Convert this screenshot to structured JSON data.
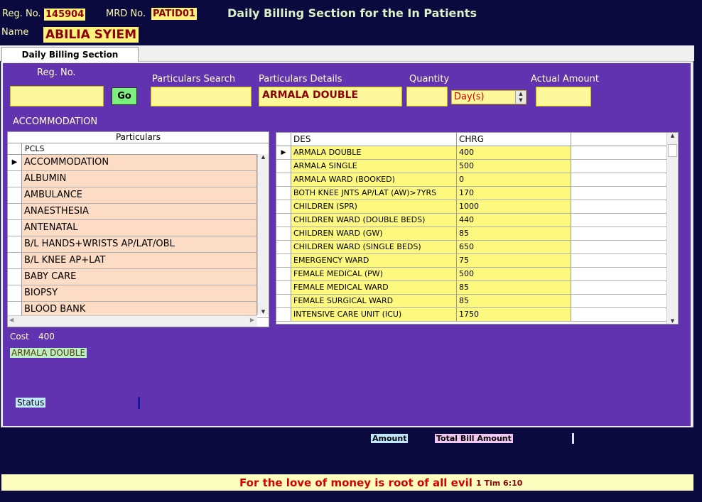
{
  "header": {
    "reg_label": "Reg. No.",
    "reg_value": "145904",
    "mrd_label": "MRD No.",
    "mrd_value": "PATID01",
    "title": "Daily Billing Section for the In Patients",
    "name_label": "Name",
    "name_value": "ABILIA SYIEM"
  },
  "tab": {
    "label": "Daily Billing Section"
  },
  "form": {
    "reg_label": "Reg. No.",
    "go_label": "Go",
    "search_label": "Particulars Search",
    "details_label": "Particulars Details",
    "details_value": "ARMALA DOUBLE",
    "quantity_label": "Quantity",
    "unit_value": "Day(s)",
    "actual_label": "Actual Amount",
    "category": "ACCOMMODATION"
  },
  "particulars_grid": {
    "caption": "Particulars",
    "column": "PCLS",
    "rows": [
      "ACCOMMODATION",
      "ALBUMIN",
      "AMBULANCE",
      "ANAESTHESIA",
      "ANTENATAL",
      "B/L HANDS+WRISTS AP/LAT/OBL",
      "B/L KNEE AP+LAT",
      "BABY CARE",
      "BIOPSY",
      "BLOOD BANK"
    ]
  },
  "charges_grid": {
    "col_des": "DES",
    "col_chrg": "CHRG",
    "rows": [
      {
        "des": "ARMALA DOUBLE",
        "chrg": "400"
      },
      {
        "des": "ARMALA SINGLE",
        "chrg": "500"
      },
      {
        "des": "ARMALA WARD (BOOKED)",
        "chrg": "0"
      },
      {
        "des": "BOTH KNEE JNTS AP/LAT (AW)>7YRS",
        "chrg": "170"
      },
      {
        "des": "CHILDREN (SPR)",
        "chrg": "1000"
      },
      {
        "des": "CHILDREN WARD (DOUBLE BEDS)",
        "chrg": "440"
      },
      {
        "des": "CHILDREN WARD (GW)",
        "chrg": "85"
      },
      {
        "des": "CHILDREN WARD (SINGLE BEDS)",
        "chrg": "650"
      },
      {
        "des": "EMERGENCY WARD",
        "chrg": "75"
      },
      {
        "des": "FEMALE MEDICAL (PW)",
        "chrg": "500"
      },
      {
        "des": "FEMALE MEDICAL WARD",
        "chrg": "85"
      },
      {
        "des": "FEMALE SURGICAL WARD",
        "chrg": "85"
      },
      {
        "des": "INTENSIVE CARE UNIT (ICU)",
        "chrg": "1750"
      }
    ]
  },
  "summary": {
    "cost_label": "Cost",
    "cost_value": "400",
    "selected_item": "ARMALA DOUBLE",
    "status_label": "Status",
    "amount_label": "Amount",
    "total_label": "Total Bill Amount"
  },
  "footer": {
    "quote": "For the love of money is root of all evil",
    "reference": "1 Tim 6:10"
  }
}
